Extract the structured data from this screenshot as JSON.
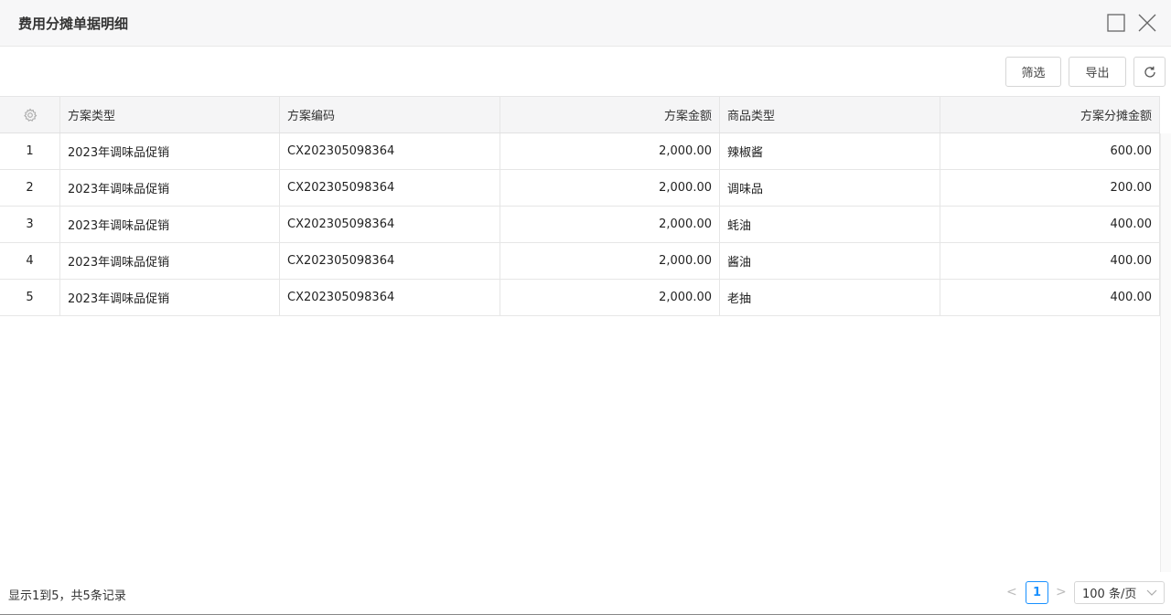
{
  "dialog": {
    "title": "费用分摊单据明细"
  },
  "toolbar": {
    "filter_label": "筛选",
    "export_label": "导出"
  },
  "table": {
    "columns": [
      "方案类型",
      "方案编码",
      "方案金额",
      "商品类型",
      "方案分摊金额"
    ],
    "rows": [
      {
        "index": "1",
        "plan_type": "2023年调味品促销",
        "plan_code": "CX202305098364",
        "plan_amount": "2,000.00",
        "product_type": "辣椒酱",
        "allocated_amount": "600.00"
      },
      {
        "index": "2",
        "plan_type": "2023年调味品促销",
        "plan_code": "CX202305098364",
        "plan_amount": "2,000.00",
        "product_type": "调味品",
        "allocated_amount": "200.00"
      },
      {
        "index": "3",
        "plan_type": "2023年调味品促销",
        "plan_code": "CX202305098364",
        "plan_amount": "2,000.00",
        "product_type": "蚝油",
        "allocated_amount": "400.00"
      },
      {
        "index": "4",
        "plan_type": "2023年调味品促销",
        "plan_code": "CX202305098364",
        "plan_amount": "2,000.00",
        "product_type": "酱油",
        "allocated_amount": "400.00"
      },
      {
        "index": "5",
        "plan_type": "2023年调味品促销",
        "plan_code": "CX202305098364",
        "plan_amount": "2,000.00",
        "product_type": "老抽",
        "allocated_amount": "400.00"
      }
    ]
  },
  "footer": {
    "summary": "显示1到5，共5条记录",
    "prev": "<",
    "current_page": "1",
    "next": ">",
    "page_size": "100 条/页"
  },
  "icons": {
    "settings": "gear-icon",
    "maximize": "maximize-icon",
    "close": "close-icon",
    "refresh": "refresh-icon",
    "dropdown": "chevron-down-icon"
  },
  "colors": {
    "accent": "#1890ff",
    "header_bg": "#f5f5f6",
    "titlebar_bg": "#f7f7f8"
  }
}
